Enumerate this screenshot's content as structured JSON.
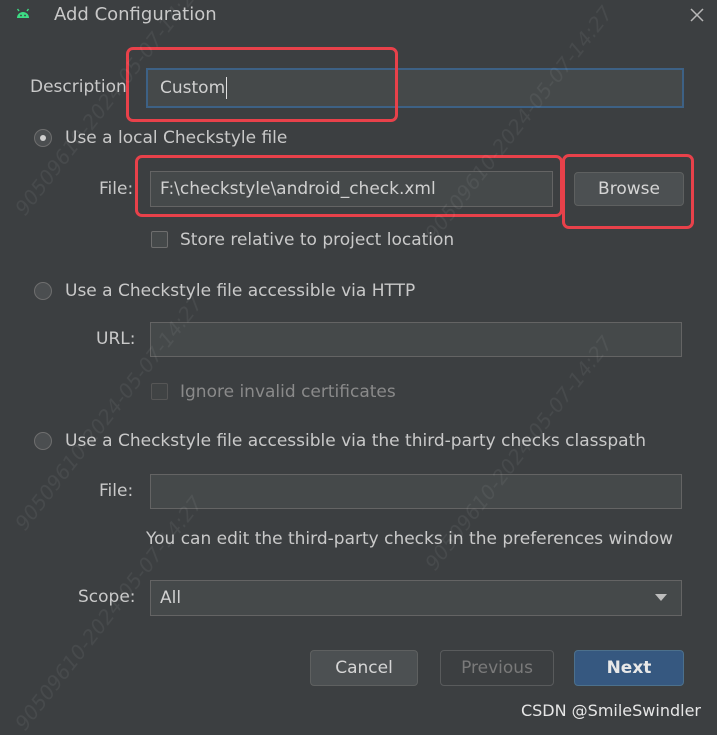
{
  "window": {
    "title": "Add Configuration"
  },
  "description": {
    "label": "Description",
    "value": "Custom"
  },
  "local": {
    "radio_label": "Use a local Checkstyle file",
    "file_label": "File:",
    "file_value": "F:\\checkstyle\\android_check.xml",
    "browse_label": "Browse",
    "store_relative_label": "Store relative to project location"
  },
  "http": {
    "radio_label": "Use a Checkstyle file accessible via HTTP",
    "url_label": "URL:",
    "url_value": "",
    "ignore_invalid_label": "Ignore invalid certificates"
  },
  "classpath": {
    "radio_label": "Use a Checkstyle file accessible via the third-party checks classpath",
    "file_label": "File:",
    "file_value": "",
    "hint": "You can edit the third-party checks in the preferences window"
  },
  "scope": {
    "label": "Scope:",
    "value": "All"
  },
  "buttons": {
    "cancel": "Cancel",
    "previous": "Previous",
    "next": "Next"
  },
  "credit": "CSDN @SmileSwindler",
  "watermark": "90509610-2024-05-07-14:27"
}
